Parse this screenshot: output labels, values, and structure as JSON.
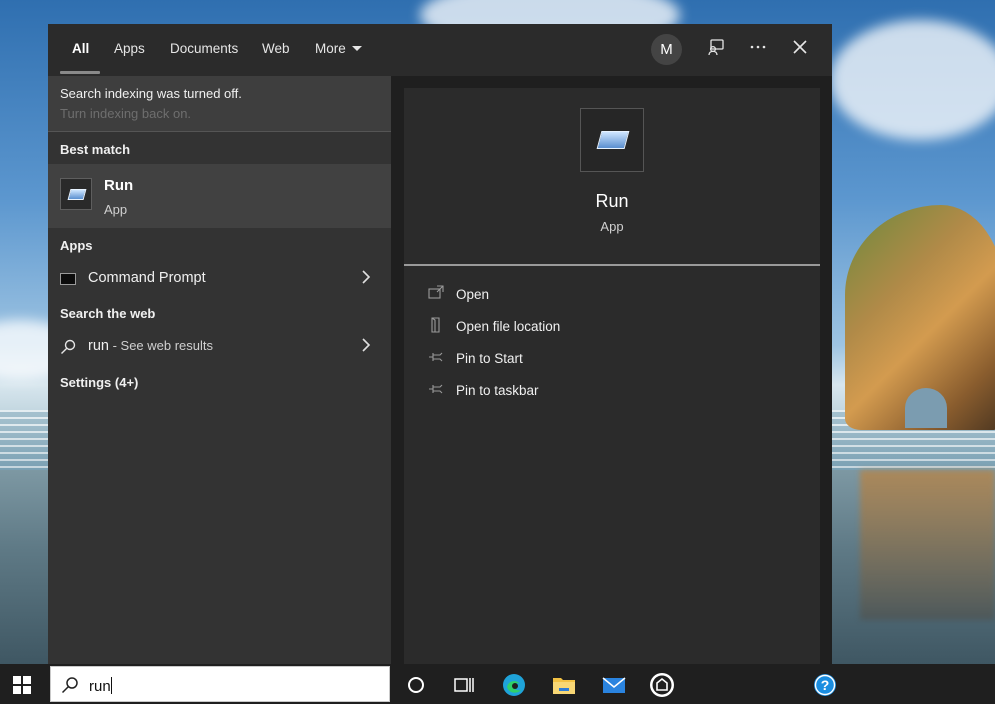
{
  "tabs": [
    {
      "label": "All",
      "active": true
    },
    {
      "label": "Apps",
      "active": false
    },
    {
      "label": "Documents",
      "active": false
    },
    {
      "label": "Web",
      "active": false
    },
    {
      "label": "More",
      "active": false
    }
  ],
  "header": {
    "avatar_initial": "M",
    "feedback_icon": "feedback-icon",
    "more_options_icon": "ellipsis-icon",
    "close_icon": "close-icon"
  },
  "notice": {
    "title": "Search indexing was turned off.",
    "link": "Turn indexing back on."
  },
  "results": {
    "best_match_heading": "Best match",
    "best_match": {
      "name": "Run",
      "kind": "App",
      "icon": "run-icon"
    },
    "apps_heading": "Apps",
    "apps": [
      {
        "label": "Command Prompt",
        "icon": "command-prompt-icon"
      }
    ],
    "web_heading": "Search the web",
    "web": {
      "query": "run",
      "suffix": " - See web results",
      "icon": "search-icon"
    },
    "settings_heading": "Settings (4+)"
  },
  "preview": {
    "name": "Run",
    "kind": "App",
    "actions": [
      {
        "label": "Open",
        "icon": "open-icon"
      },
      {
        "label": "Open file location",
        "icon": "file-location-icon"
      },
      {
        "label": "Pin to Start",
        "icon": "pin-icon"
      },
      {
        "label": "Pin to taskbar",
        "icon": "pin-icon"
      }
    ]
  },
  "taskbar": {
    "search_value": "run",
    "icons": [
      "start-icon",
      "cortana-icon",
      "task-view-icon",
      "edge-icon",
      "file-explorer-icon",
      "mail-icon",
      "app-icon",
      "help-icon"
    ]
  },
  "colors": {
    "flyout_bg": "#1f1f1f",
    "left_pane_bg": "#333333",
    "best_match_bg": "#414141",
    "preview_bg": "#2b2b2b",
    "taskbar_bg": "#1f1f1f",
    "edge_accent": "#1fa3d9",
    "help_accent": "#1a8de0"
  }
}
